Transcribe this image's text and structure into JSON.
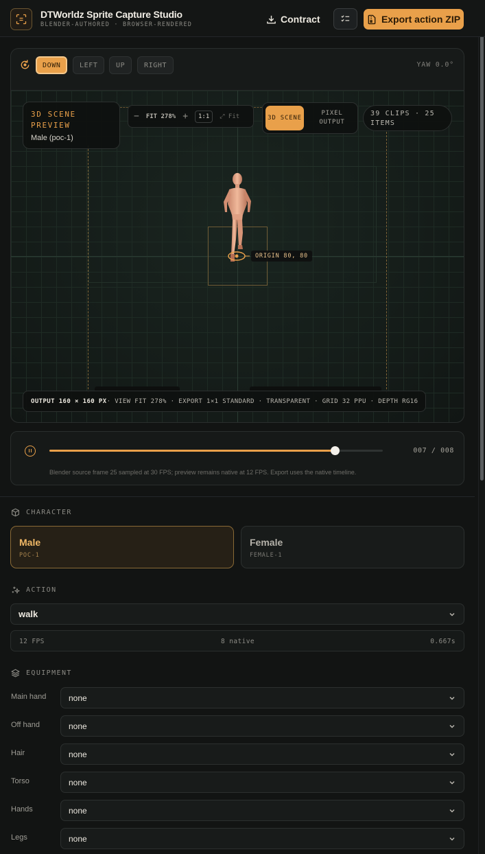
{
  "header": {
    "title": "DTWorldz Sprite Capture Studio",
    "subtitle": "BLENDER-AUTHORED · BROWSER-RENDERED",
    "contract_label": "Contract",
    "export_label": "Export action ZIP"
  },
  "directions": {
    "items": [
      "DOWN",
      "LEFT",
      "UP",
      "RIGHT"
    ],
    "active": "DOWN",
    "yaw": "YAW 0.0°"
  },
  "viewport": {
    "scene_title": "3D SCENE PREVIEW",
    "character": "Male (poc-1)",
    "fit_label": "FIT 278%",
    "one_to_one": "1:1",
    "fit_button": "Fit",
    "mode_scene": "3D SCENE",
    "mode_pixel": "PIXEL OUTPUT",
    "clips": "39 CLIPS · 25 ITEMS",
    "origin": "ORIGIN 80, 80",
    "status_output": "OUTPUT 160 × 160 PX",
    "status_rest": " · VIEW FIT 278% · EXPORT 1×1 STANDARD · TRANSPARENT · GRID 32 PPU · DEPTH RG16"
  },
  "playback": {
    "frame": "007 / 008",
    "progress": 0.856,
    "note": "Blender source frame 25 sampled at 30 FPS; preview remains native at 12 FPS. Export uses the native timeline."
  },
  "character": {
    "heading": "CHARACTER",
    "options": [
      {
        "name": "Male",
        "code": "POC-1",
        "selected": true
      },
      {
        "name": "Female",
        "code": "FEMALE-1",
        "selected": false
      }
    ]
  },
  "action": {
    "heading": "ACTION",
    "value": "walk",
    "fps": "12 FPS",
    "native": "8 native",
    "duration": "0.667s"
  },
  "equipment": {
    "heading": "EQUIPMENT",
    "slots": [
      {
        "label": "Main hand",
        "value": "none"
      },
      {
        "label": "Off hand",
        "value": "none"
      },
      {
        "label": "Hair",
        "value": "none"
      },
      {
        "label": "Torso",
        "value": "none"
      },
      {
        "label": "Hands",
        "value": "none"
      },
      {
        "label": "Legs",
        "value": "none"
      }
    ]
  },
  "colors": {
    "accent": "#e9a04a",
    "background": "#121413",
    "grid": "#1e2b24"
  }
}
